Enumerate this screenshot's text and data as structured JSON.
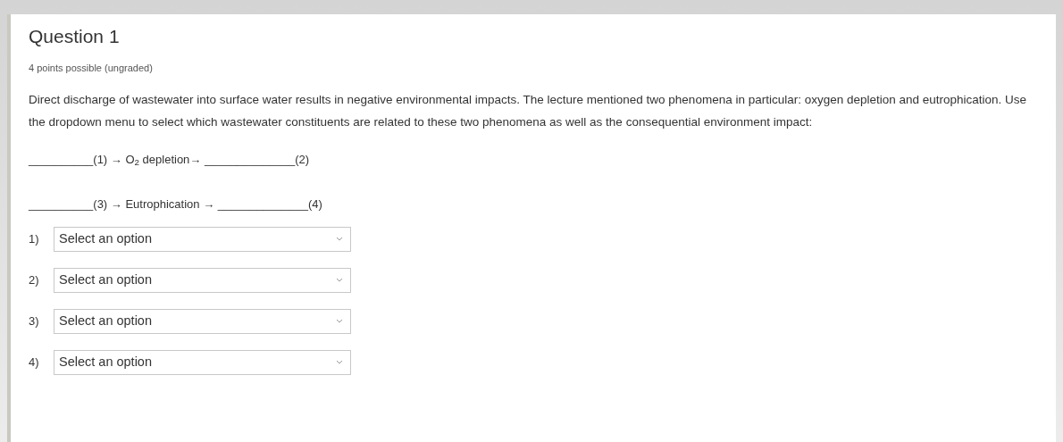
{
  "question": {
    "title": "Question 1",
    "points": "4 points possible (ungraded)",
    "prompt": "Direct discharge of wastewater into surface water results in negative environmental impacts. The lecture mentioned two phenomena in particular: oxygen depletion and eutrophication. Use the dropdown menu to select which wastewater constituents are related to these two phenomena as well as the consequential environment impact:",
    "equations": [
      "__________(1) → O$_{2}$ depletion→ ______________(2)",
      "__________(3) → Eutrophication → ______________(4)"
    ],
    "dropdowns": [
      {
        "label": "1)",
        "value": "Select an option"
      },
      {
        "label": "2)",
        "value": "Select an option"
      },
      {
        "label": "3)",
        "value": "Select an option"
      },
      {
        "label": "4)",
        "value": "Select an option"
      }
    ]
  }
}
